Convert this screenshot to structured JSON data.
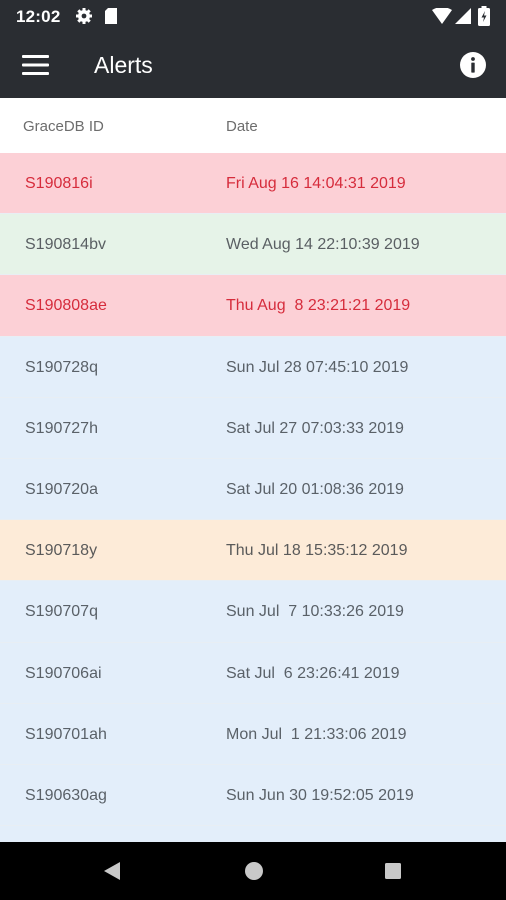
{
  "status_bar": {
    "time": "12:02"
  },
  "app_bar": {
    "title": "Alerts"
  },
  "table": {
    "headers": {
      "id": "GraceDB ID",
      "date": "Date"
    },
    "rows": [
      {
        "id": "S190816i",
        "date": "Fri Aug 16 14:04:31 2019",
        "color": "red"
      },
      {
        "id": "S190814bv",
        "date": "Wed Aug 14 22:10:39 2019",
        "color": "green"
      },
      {
        "id": "S190808ae",
        "date": "Thu Aug  8 23:21:21 2019",
        "color": "red"
      },
      {
        "id": "S190728q",
        "date": "Sun Jul 28 07:45:10 2019",
        "color": "blue"
      },
      {
        "id": "S190727h",
        "date": "Sat Jul 27 07:03:33 2019",
        "color": "blue"
      },
      {
        "id": "S190720a",
        "date": "Sat Jul 20 01:08:36 2019",
        "color": "blue"
      },
      {
        "id": "S190718y",
        "date": "Thu Jul 18 15:35:12 2019",
        "color": "orange"
      },
      {
        "id": "S190707q",
        "date": "Sun Jul  7 10:33:26 2019",
        "color": "blue"
      },
      {
        "id": "S190706ai",
        "date": "Sat Jul  6 23:26:41 2019",
        "color": "blue"
      },
      {
        "id": "S190701ah",
        "date": "Mon Jul  1 21:33:06 2019",
        "color": "blue"
      },
      {
        "id": "S190630ag",
        "date": "Sun Jun 30 19:52:05 2019",
        "color": "blue"
      },
      {
        "id": "",
        "date": "",
        "color": "blue"
      }
    ]
  },
  "row_colors": {
    "red": "#fcd0d6",
    "green": "#e6f3e8",
    "blue": "#e3eefa",
    "orange": "#fdebd8"
  },
  "icons": {
    "status_bar": [
      "settings-icon",
      "sd-card-icon",
      "wifi-icon",
      "signal-icon",
      "battery-icon"
    ],
    "app_bar": [
      "menu-icon",
      "info-icon"
    ],
    "nav_bar": [
      "back-icon",
      "home-icon",
      "recents-icon"
    ]
  }
}
